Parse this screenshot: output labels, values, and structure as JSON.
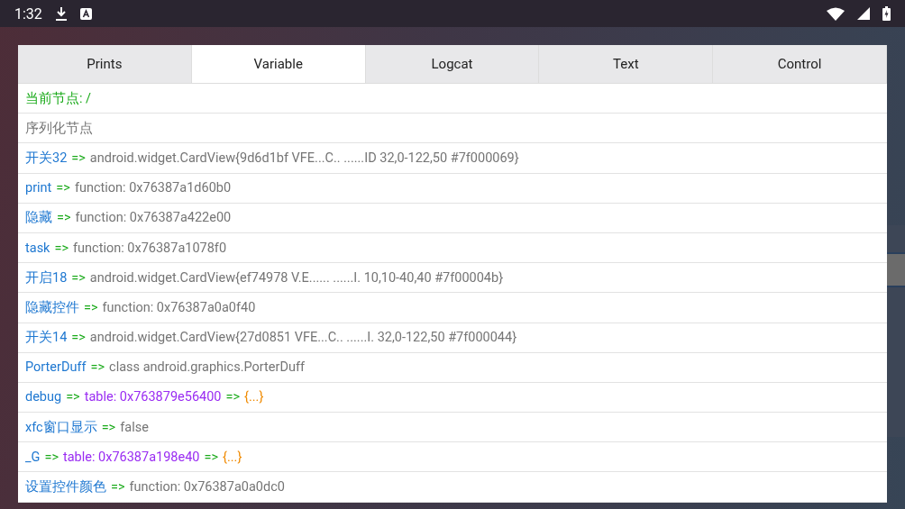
{
  "status_bar": {
    "time": "1:32"
  },
  "tabs": [
    {
      "label": "Prints",
      "selected": false
    },
    {
      "label": "Variable",
      "selected": true
    },
    {
      "label": "Logcat",
      "selected": false
    },
    {
      "label": "Text",
      "selected": false
    },
    {
      "label": "Control",
      "selected": false
    }
  ],
  "current_node": "当前节点: /",
  "serialize_label": "序列化节点",
  "variables": [
    {
      "kind": "plain",
      "name": "开关32",
      "arrow": "=>",
      "value": "android.widget.CardView{9d6d1bf VFE...C.. ......ID 32,0-122,50 #7f000069}"
    },
    {
      "kind": "plain",
      "name": "print",
      "arrow": "=>",
      "value": "function: 0x76387a1d60b0"
    },
    {
      "kind": "plain",
      "name": "隐藏",
      "arrow": "=>",
      "value": "function: 0x76387a422e00"
    },
    {
      "kind": "plain",
      "name": "task",
      "arrow": "=>",
      "value": "function: 0x76387a1078f0"
    },
    {
      "kind": "plain",
      "name": "开启18",
      "arrow": "=>",
      "value": "android.widget.CardView{ef74978 V.E...... ......I. 10,10-40,40 #7f00004b}"
    },
    {
      "kind": "plain",
      "name": "隐藏控件",
      "arrow": "=>",
      "value": "function: 0x76387a0a0f40"
    },
    {
      "kind": "plain",
      "name": "开关14",
      "arrow": "=>",
      "value": "android.widget.CardView{27d0851 VFE...C.. ......I. 32,0-122,50 #7f000044}"
    },
    {
      "kind": "plain",
      "name": "PorterDuff",
      "arrow": "=>",
      "value": "class android.graphics.PorterDuff"
    },
    {
      "kind": "table",
      "name": "debug",
      "arrow": "=>",
      "value": "table: 0x763879e56400",
      "arrow2": "=>",
      "expand": "{...}"
    },
    {
      "kind": "plain",
      "name": "xfc窗口显示",
      "arrow": "=>",
      "value": "false"
    },
    {
      "kind": "table",
      "name": "_G",
      "arrow": "=>",
      "value": "table: 0x76387a198e40",
      "arrow2": "=>",
      "expand": "{...}"
    },
    {
      "kind": "plain",
      "name": "设置控件颜色",
      "arrow": "=>",
      "value": "function: 0x76387a0a0dc0"
    }
  ]
}
